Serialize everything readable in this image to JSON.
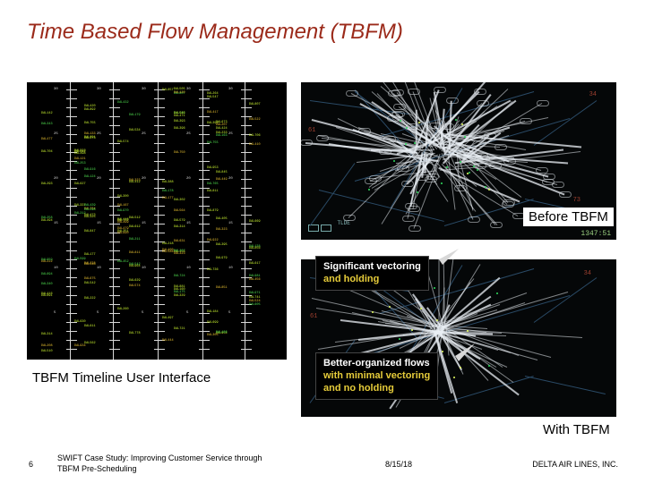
{
  "title": "Time Based Flow Management (TBFM)",
  "timeline_caption": "TBFM Timeline User Interface",
  "before": {
    "callout_l1": "Significant vectoring",
    "callout_l2": "and holding",
    "label": "Before TBFM",
    "time": "1347:51"
  },
  "after": {
    "callout_l1": "Better-organized flows",
    "callout_l2": "with minimal vectoring",
    "callout_l3": "and no holding",
    "label": "With TBFM"
  },
  "footer": {
    "page": "6",
    "title": "SWIFT Case Study: Improving Customer Service through TBFM Pre-Scheduling",
    "date": "8/15/18",
    "company": "DELTA AIR LINES, INC."
  },
  "radar_boxes_label": "TLDE"
}
